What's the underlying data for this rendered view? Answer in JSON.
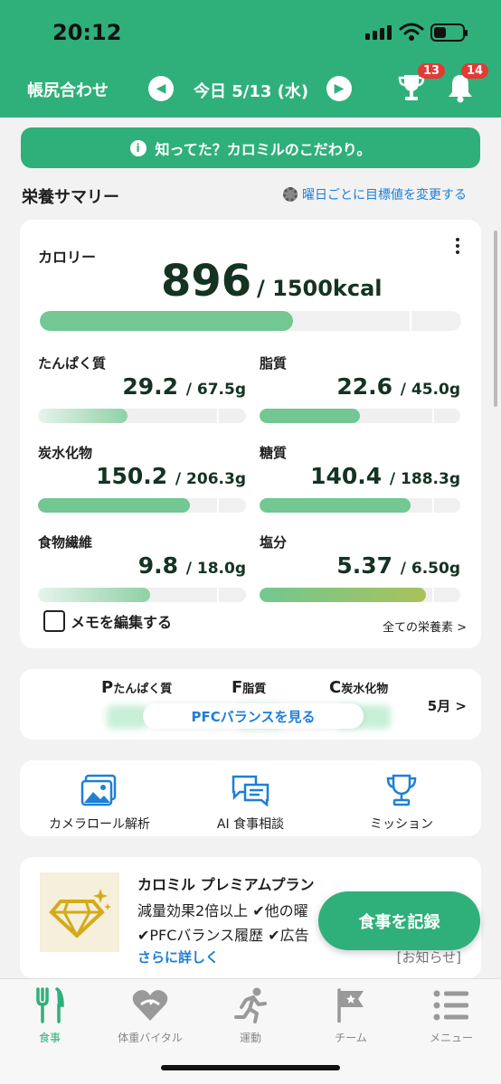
{
  "status": {
    "time": "20:12"
  },
  "header": {
    "left_label": "帳尻合わせ",
    "date_label": "今日 5/13 (水)",
    "trophy_badge": "13",
    "bell_badge": "14"
  },
  "banner": {
    "text": "知ってた？カロミルのこだわり。"
  },
  "summary": {
    "title": "栄養サマリー",
    "goal_link": "曜日ごとに目標値を変更する",
    "calorie": {
      "label": "カロリー",
      "value": "896",
      "goal": "/ 1500kcal",
      "progress": 0.6
    },
    "nutrients": [
      {
        "label": "たんぱく質",
        "value": "29.2",
        "goal": "/ 67.5g",
        "progress": 0.43
      },
      {
        "label": "脂質",
        "value": "22.6",
        "goal": "/ 45.0g",
        "progress": 0.5
      },
      {
        "label": "炭水化物",
        "value": "150.2",
        "goal": "/ 206.3g",
        "progress": 0.73
      },
      {
        "label": "糖質",
        "value": "140.4",
        "goal": "/ 188.3g",
        "progress": 0.75
      },
      {
        "label": "食物繊維",
        "value": "9.8",
        "goal": "/ 18.0g",
        "progress": 0.54
      },
      {
        "label": "塩分",
        "value": "5.37",
        "goal": "/ 6.50g",
        "progress": 0.83
      }
    ],
    "memo_label": "メモを編集する",
    "all_nutrients": "全ての栄養素 >"
  },
  "pfc": {
    "p_letter": "P",
    "p_label": "たんぱく質",
    "f_letter": "F",
    "f_label": "脂質",
    "c_letter": "C",
    "c_label": "炭水化物",
    "button": "PFCバランスを見る",
    "month": "5月 >"
  },
  "tools": [
    {
      "label": "カメラロール解析",
      "icon": "photos-icon"
    },
    {
      "label": "AI 食事相談",
      "icon": "chat-icon"
    },
    {
      "label": "ミッション",
      "icon": "trophy-icon"
    }
  ],
  "premium": {
    "title": "カロミル プレミアムプラン",
    "line1": "減量効果2倍以上 ✔他の曜",
    "line2": "✔PFCバランス履歴 ✔広告",
    "more": "さらに詳しく",
    "notice": "[お知らせ]"
  },
  "fab": {
    "label": "食事を記録"
  },
  "tabs": [
    {
      "label": "食事",
      "icon": "fork-knife-icon",
      "active": true
    },
    {
      "label": "体重バイタル",
      "icon": "heart-scale-icon"
    },
    {
      "label": "運動",
      "icon": "runner-icon"
    },
    {
      "label": "チーム",
      "icon": "flag-icon"
    },
    {
      "label": "メニュー",
      "icon": "list-icon"
    }
  ],
  "colors": {
    "brand": "#2fb07a",
    "link": "#1e7fd6",
    "badge": "#e53935",
    "bar": "#72c792"
  }
}
